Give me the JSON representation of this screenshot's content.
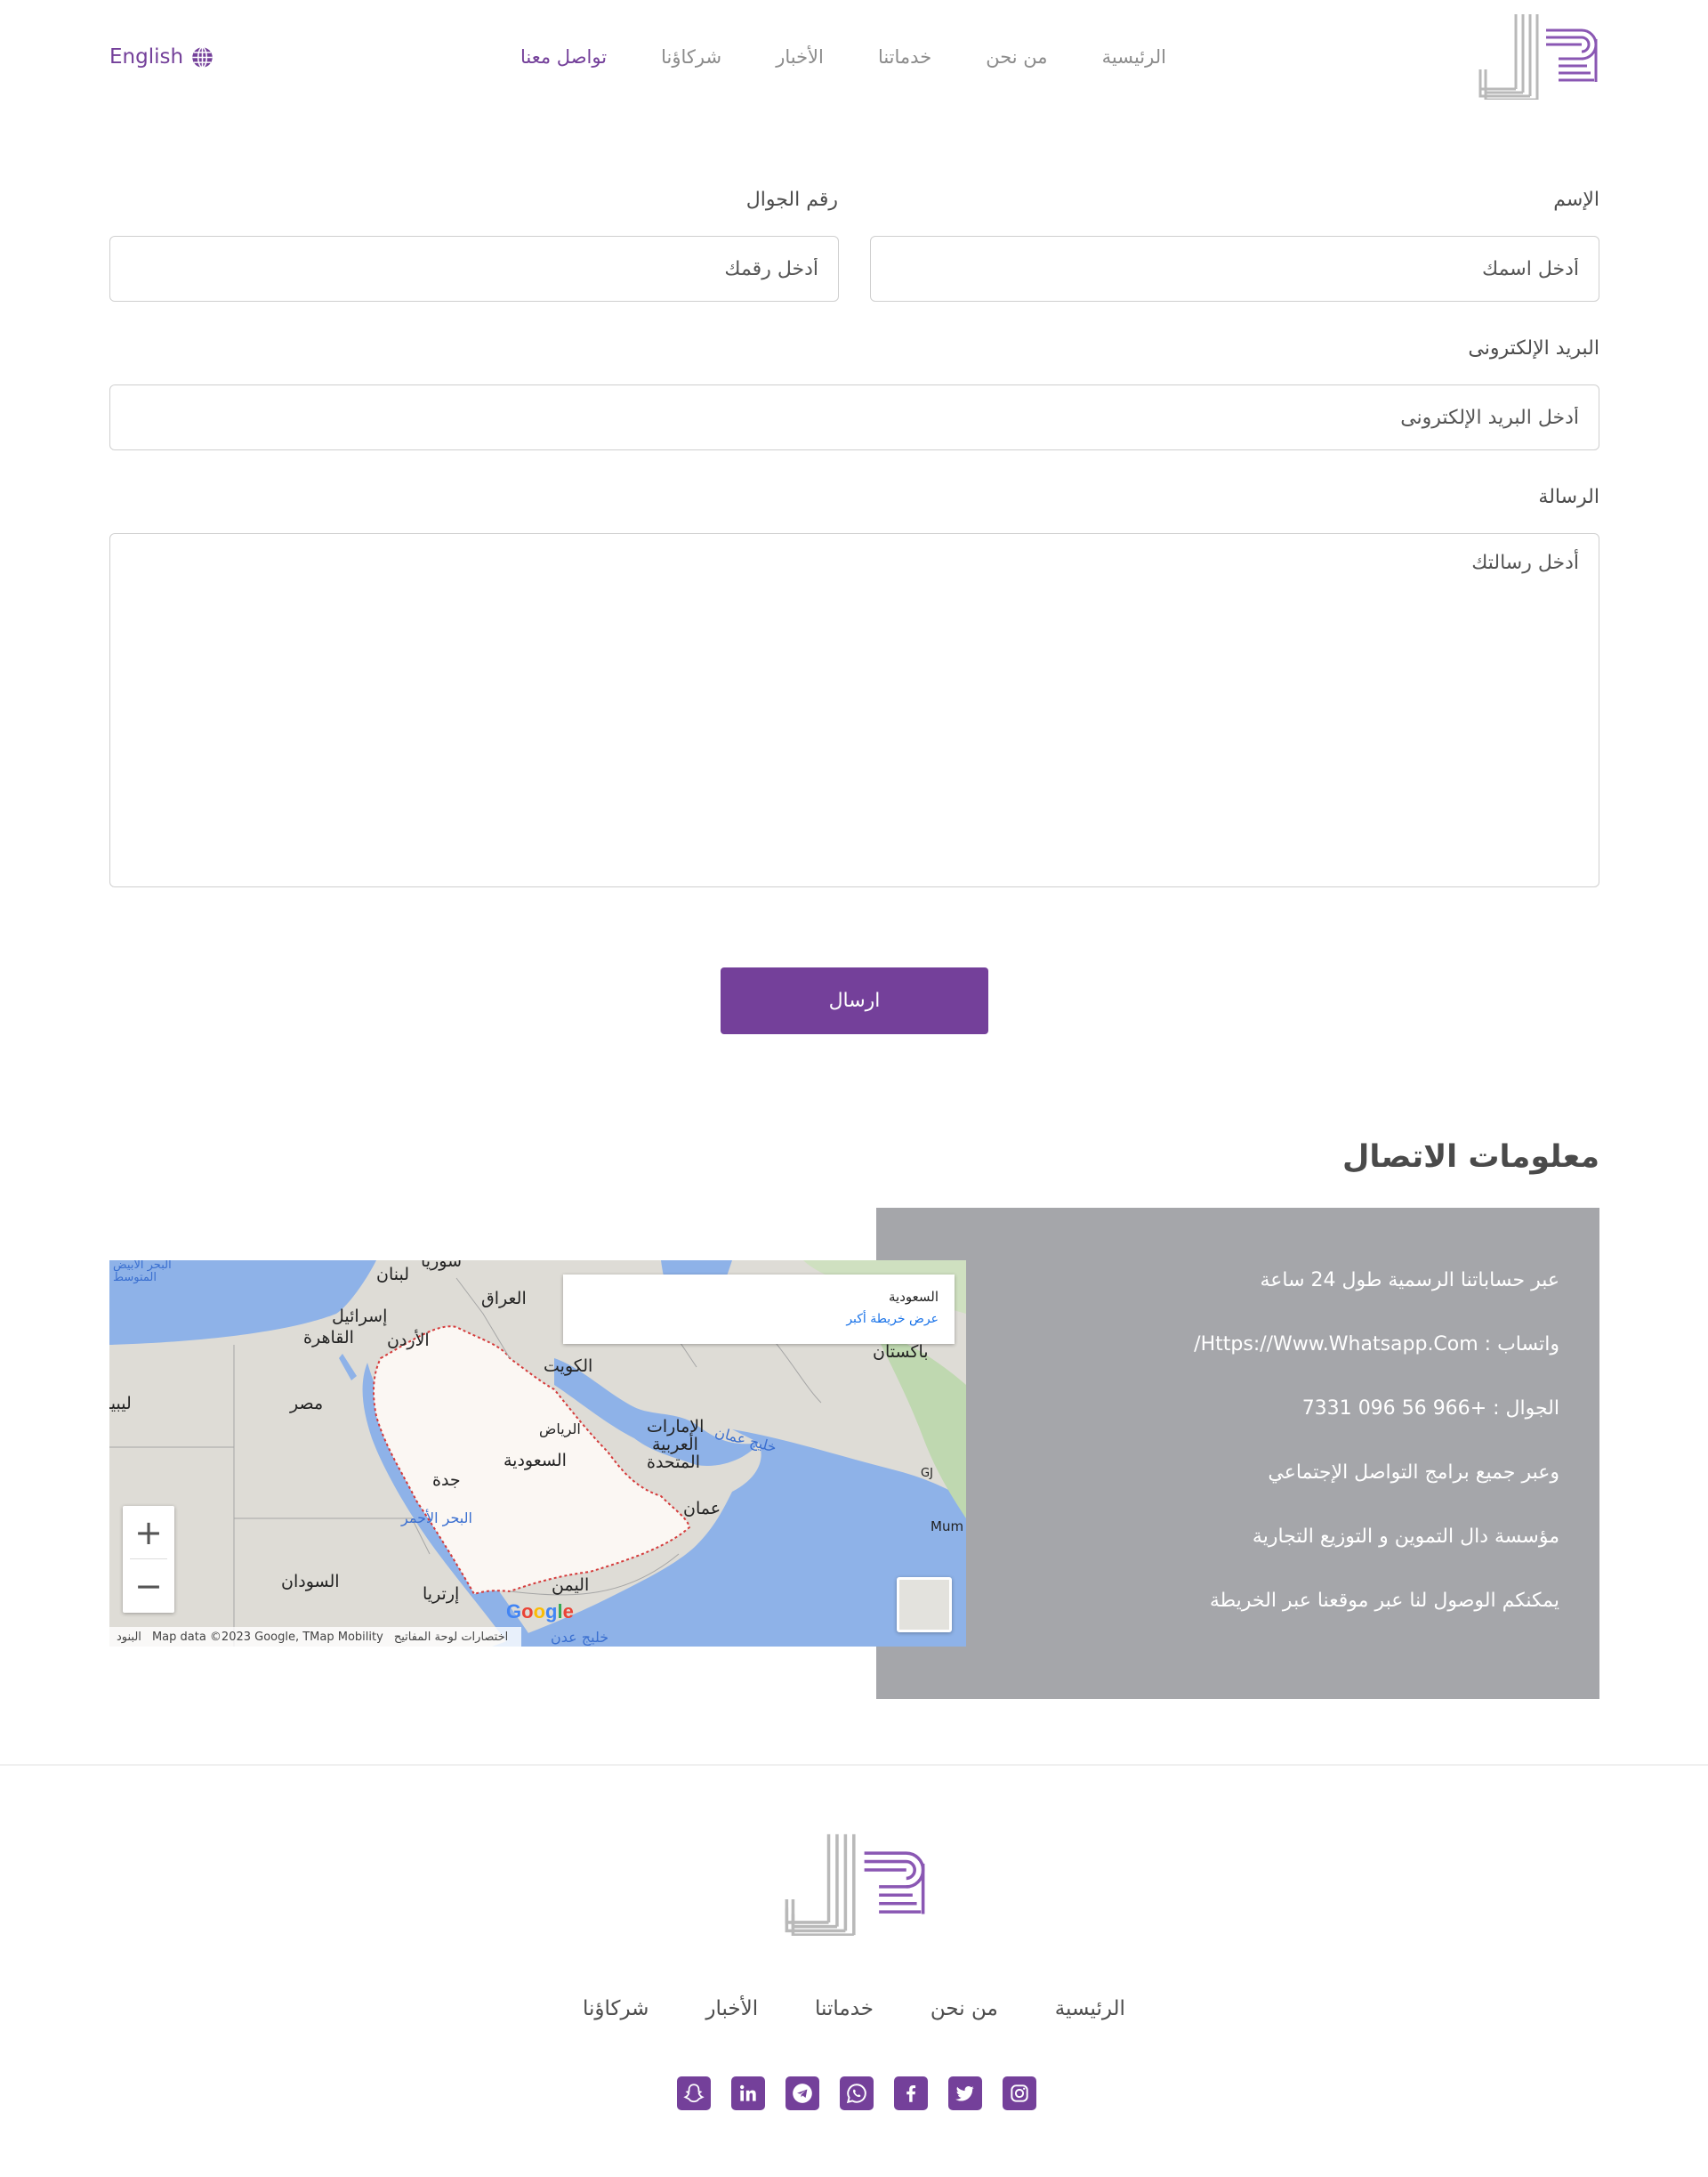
{
  "header": {
    "nav": [
      {
        "label": "الرئيسية"
      },
      {
        "label": "من نحن"
      },
      {
        "label": "خدماتنا"
      },
      {
        "label": "الأخبار"
      },
      {
        "label": "شركاؤنا"
      },
      {
        "label": "تواصل معنا",
        "active": true
      }
    ],
    "language_label": "English"
  },
  "form": {
    "name_label": "الإسم",
    "name_placeholder": "أدخل اسمك",
    "phone_label": "رقم الجوال",
    "phone_placeholder": "أدخل رقمك",
    "email_label": "البريد الإلكترونى",
    "email_placeholder": "أدخل البريد الإلكترونى",
    "message_label": "الرسالة",
    "message_placeholder": "أدخل رسالتك",
    "submit_label": "ارسال"
  },
  "contact": {
    "title": "معلومات الاتصال",
    "lines": [
      "عبر حساباتنا الرسمية طول 24 ساعة",
      "واتساب : Https://Www.Whatsapp.Com/",
      "الجوال : +966 56 096 7331",
      "وعبر جميع برامج التواصل الإجتماعي",
      "مؤسسة دال التموين و التوزيع التجارية",
      "يمكنكم الوصول لنا عبر موقعنا عبر الخريطة"
    ]
  },
  "map": {
    "card_title": "السعودية",
    "card_link": "عرض خريطة أكبر",
    "zoom_in": "+",
    "zoom_out": "−",
    "attribution": "Map data ©2023 Google, TMap Mobility",
    "shortcuts": "اختصارات لوحة المفاتيح",
    "terms": "البنود",
    "google_logo": "Google",
    "labels": {
      "lebanon": "لبنان",
      "syria": "سوريا",
      "iraq": "العراق",
      "israel": "إسرائيل",
      "cairo": "القاهرة",
      "jordan": "الأردن",
      "kuwait": "الكويت",
      "pakistan": "باكستان",
      "egypt": "مصر",
      "libya": "ليبيا",
      "riyadh": "الرياض",
      "saudi": "السعودية",
      "uae_1": "الإمارات",
      "uae_2": "العربية",
      "uae_3": "المتحدة",
      "jeddah": "جدة",
      "oman": "عمان",
      "red_sea": "البحر الأحمر",
      "gulf_oman": "خليج عمان",
      "sudan": "السودان",
      "eritrea": "إرتريا",
      "yemen": "اليمن",
      "med_sea_1": "البحر الأبيض",
      "med_sea_2": "المتوسط",
      "gulf_aden": "خليج عدن",
      "mumbai": "Mum",
      "gj": "GJ"
    }
  },
  "footer": {
    "nav": [
      {
        "label": "الرئيسية"
      },
      {
        "label": "من نحن"
      },
      {
        "label": "خدماتنا"
      },
      {
        "label": "الأخبار"
      },
      {
        "label": "شركاؤنا"
      }
    ],
    "socials": [
      "instagram-icon",
      "twitter-icon",
      "facebook-icon",
      "whatsapp-icon",
      "telegram-icon",
      "linkedin-icon",
      "snapchat-icon"
    ]
  },
  "colors": {
    "brand": "#74409a",
    "info_box": "#a5a6aa",
    "water": "#8eb2e8",
    "land": "#dedcd6"
  }
}
